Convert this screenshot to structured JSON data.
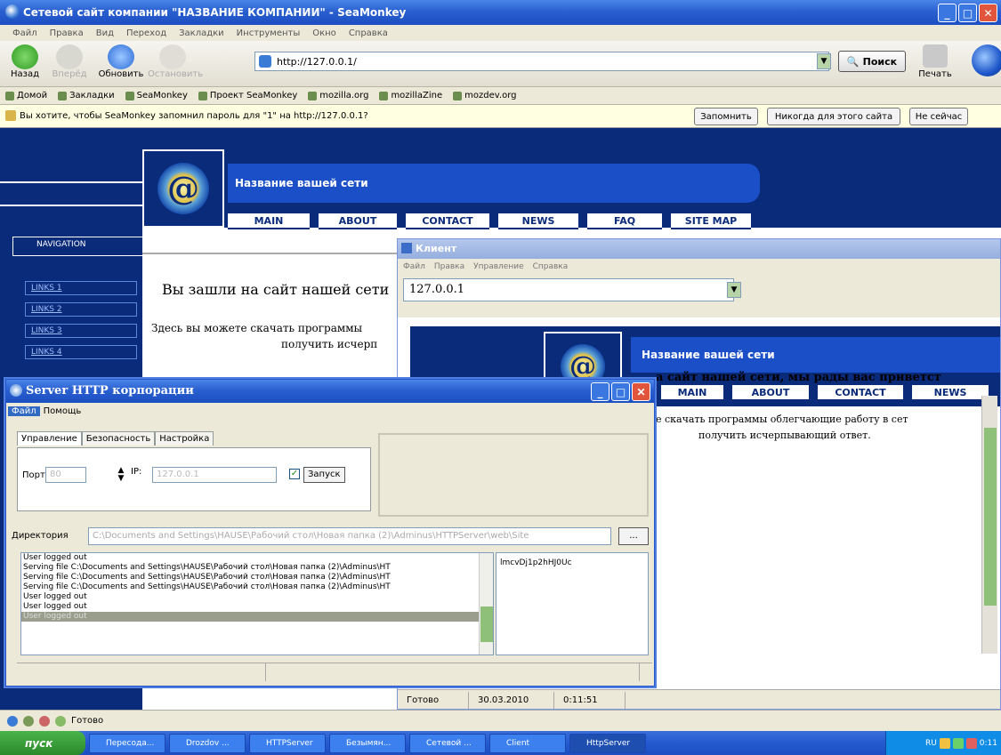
{
  "browser": {
    "title": "Сетевой сайт компании \"НАЗВАНИЕ КОМПАНИИ\" - SeaMonkey",
    "menu": [
      "Файл",
      "Правка",
      "Вид",
      "Переход",
      "Закладки",
      "Инструменты",
      "Окно",
      "Справка"
    ],
    "nav": {
      "back": "Назад",
      "forward": "Вперёд",
      "reload": "Обновить",
      "stop": "Остановить"
    },
    "url": "http://127.0.0.1/",
    "search_label": "Поиск",
    "print_label": "Печать",
    "bookmarks": [
      "Домой",
      "Закладки",
      "SeaMonkey",
      "Проект SeaMonkey",
      "mozilla.org",
      "mozillaZine",
      "mozdev.org"
    ],
    "notification": {
      "text": "Вы хотите, чтобы SeaMonkey запомнил пароль для \"1\" на http://127.0.0.1?",
      "remember": "Запомнить",
      "never": "Никогда для этого сайта",
      "not_now": "Не сейчас"
    },
    "status": "Готово"
  },
  "site": {
    "title": "Название вашей сети",
    "tabs": [
      "MAIN",
      "ABOUT",
      "CONTACT",
      "NEWS",
      "FAQ",
      "SITE MAP"
    ],
    "navigation_label": "NAVIGATION",
    "links": [
      "LINKS 1",
      "LINKS 2",
      "LINKS 3",
      "LINKS 4"
    ],
    "welcome": "Вы зашли на сайт нашей сети",
    "desc1": "Здесь вы можете скачать программы",
    "desc2": "получить исчерп"
  },
  "client": {
    "title": "Клиент",
    "menu": [
      "Файл",
      "Правка",
      "Управление",
      "Справка"
    ],
    "url": "127.0.0.1",
    "site_title": "Название вашей сети",
    "tabs": [
      "MAIN",
      "ABOUT",
      "CONTACT",
      "NEWS"
    ],
    "text1": "а сайт нашей сети, мы рады вас приветст",
    "text2": "е скачать программы облегчающие работу в сет",
    "text3": "получить исчерпывающий ответ.",
    "status": {
      "state": "Готово",
      "date": "30.03.2010",
      "time": "0:11:51"
    }
  },
  "server": {
    "title": "Server HTTP корпорации",
    "menu": [
      "Файл",
      "Помощь"
    ],
    "tabs": [
      "Управление",
      "Безопасность",
      "Настройка"
    ],
    "port_label": "Порт:",
    "port_value": "80",
    "ip_label": "IP:",
    "ip_value": "127.0.0.1",
    "start_label": "Запуск",
    "start_checked": true,
    "dir_label": "Директория",
    "dir_value": "C:\\Documents and Settings\\HAUSE\\Рабочий стол\\Новая папка (2)\\Adminus\\HTTPServer\\web\\Site",
    "browse_label": "...",
    "log": [
      "User logged out",
      "Serving file C:\\Documents and Settings\\HAUSE\\Рабочий стол\\Новая папка (2)\\Adminus\\HT",
      "Serving file C:\\Documents and Settings\\HAUSE\\Рабочий стол\\Новая папка (2)\\Adminus\\HT",
      "Serving file C:\\Documents and Settings\\HAUSE\\Рабочий стол\\Новая папка (2)\\Adminus\\HT",
      "User logged out",
      "User logged out",
      "User logged out"
    ],
    "session": "lmcvDj1p2hHJ0Uc"
  },
  "taskbar": {
    "start": "пуск",
    "tasks": [
      "Пересода...",
      "Drozdov ...",
      "HTTPServer",
      "Безымян...",
      "Сетевой ...",
      "Client",
      "HttpServer"
    ],
    "tray_lang": "RU",
    "clock": "0:11"
  }
}
